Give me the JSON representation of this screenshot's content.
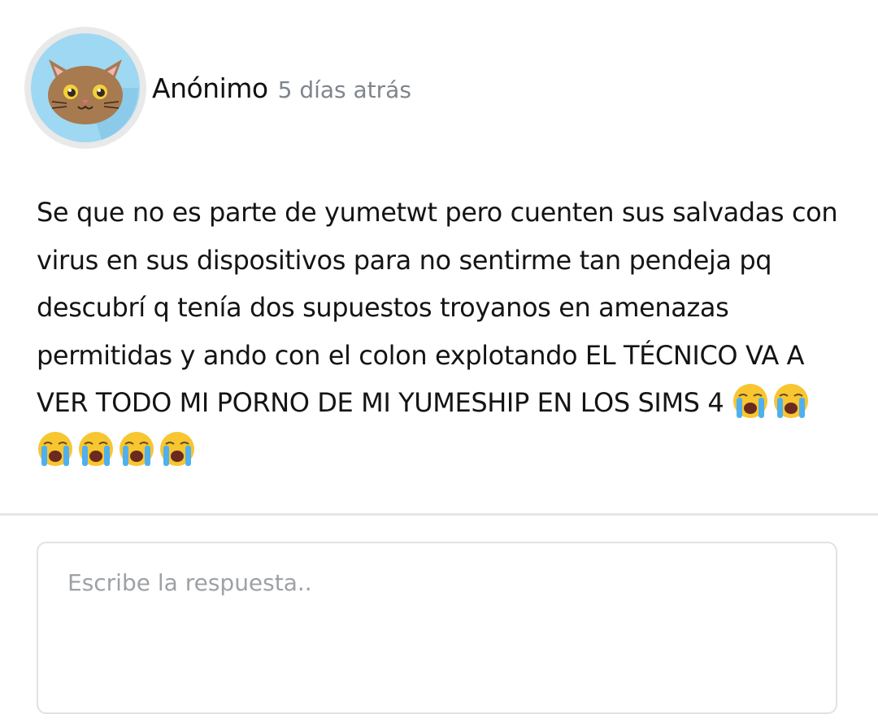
{
  "post": {
    "author": "Anónimo",
    "time": "5 días atrás",
    "avatar_icon": "cat-avatar-icon",
    "text": "Se que no es parte de yumetwt pero cuenten sus salvadas con virus en sus dispositivos para no sentirme tan pendeja pq descubrí q tenía dos supuestos troyanos en amenazas permitidas y ando con el colon explotando EL TÉCNICO VA A VER TODO MI PORNO DE MI YUMESHIP EN LOS SIMS 4",
    "emojis": [
      "crying-face-icon",
      "crying-face-icon",
      "crying-face-icon",
      "crying-face-icon",
      "crying-face-icon",
      "crying-face-icon"
    ]
  },
  "reply": {
    "placeholder": "Escribe la respuesta..",
    "value": ""
  },
  "colors": {
    "avatar_bg": "#9fd8f2",
    "cat_fur": "#a87a4f",
    "time_text": "#7f858c",
    "divider": "#e6e6e6"
  }
}
